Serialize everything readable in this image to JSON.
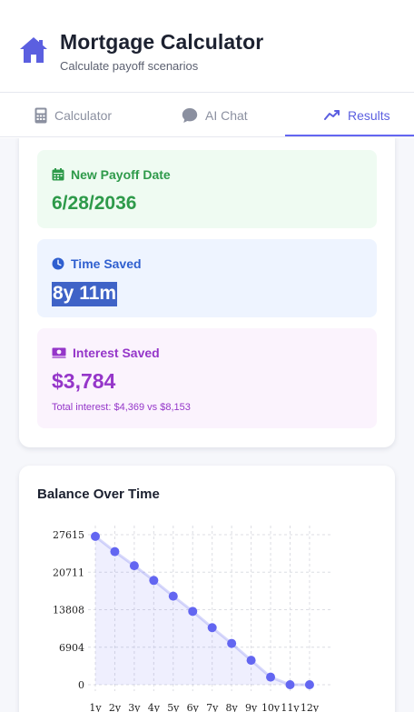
{
  "header": {
    "title": "Mortgage Calculator",
    "subtitle": "Calculate payoff scenarios",
    "logo_icon": "house-icon",
    "accent": "#6366f1"
  },
  "tabs": [
    {
      "label": "Calculator",
      "icon": "calculator-icon",
      "active": false
    },
    {
      "label": "AI Chat",
      "icon": "chat-bubble-icon",
      "active": false
    },
    {
      "label": "Results",
      "icon": "trend-line-icon",
      "active": true
    }
  ],
  "stats": {
    "payoff": {
      "label": "New Payoff Date",
      "value": "6/28/2036",
      "icon": "calendar-icon",
      "color": "#2e9a4a"
    },
    "time": {
      "label": "Time Saved",
      "value": "8y 11m",
      "icon": "clock-icon",
      "color": "#2f5fcf"
    },
    "interest": {
      "label": "Interest Saved",
      "value": "$3,784",
      "note": "Total interest: $4,369 vs $8,153",
      "icon": "money-icon",
      "color": "#9536c9"
    }
  },
  "chart_title": "Balance Over Time",
  "chart_data": {
    "type": "area",
    "title": "Balance Over Time",
    "xlabel": "",
    "ylabel": "",
    "x": [
      "1y",
      "2y",
      "3y",
      "4y",
      "5y",
      "6y",
      "7y",
      "8y",
      "9y",
      "10y",
      "11y",
      "12y"
    ],
    "y_ticks": [
      "27615",
      "20711",
      "13808",
      "6904",
      "0"
    ],
    "ylim": [
      0,
      27615
    ],
    "grid": true,
    "series": [
      {
        "values": [
          27300,
          24500,
          21900,
          19200,
          16300,
          13500,
          10500,
          7600,
          4500,
          1400,
          0,
          0
        ],
        "color": "#6366f1"
      }
    ]
  }
}
